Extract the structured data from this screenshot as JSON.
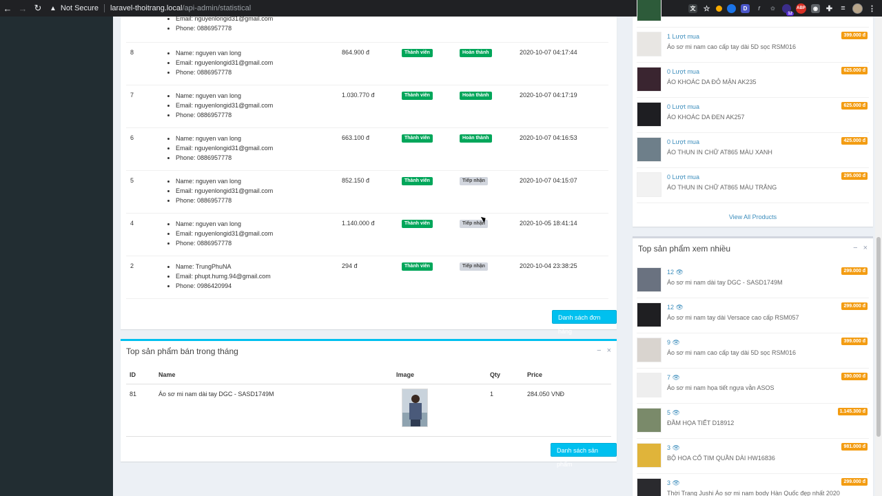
{
  "browser": {
    "security_label": "Not Secure",
    "url_host": "laravel-thoitrang.local",
    "url_path": "/api-admin/statistical",
    "ext_badge_count": "12",
    "ext_d_label": "D",
    "ext_abp_label": "ABP"
  },
  "orders": {
    "partial_top": {
      "email": "Email: nguyenlongid31@gmail.com",
      "phone": "Phone: 0886957778"
    },
    "rows": [
      {
        "id": "8",
        "name": "Name: nguyen van long",
        "email": "Email: nguyenlongid31@gmail.com",
        "phone": "Phone: 0886957778",
        "total": "864.900 đ",
        "type": "Thành viên",
        "status": "Hoàn thành",
        "status_type": "done",
        "date": "2020-10-07 04:17:44"
      },
      {
        "id": "7",
        "name": "Name: nguyen van long",
        "email": "Email: nguyenlongid31@gmail.com",
        "phone": "Phone: 0886957778",
        "total": "1.030.770 đ",
        "type": "Thành viên",
        "status": "Hoàn thành",
        "status_type": "done",
        "date": "2020-10-07 04:17:19"
      },
      {
        "id": "6",
        "name": "Name: nguyen van long",
        "email": "Email: nguyenlongid31@gmail.com",
        "phone": "Phone: 0886957778",
        "total": "663.100 đ",
        "type": "Thành viên",
        "status": "Hoàn thành",
        "status_type": "done",
        "date": "2020-10-07 04:16:53"
      },
      {
        "id": "5",
        "name": "Name: nguyen van long",
        "email": "Email: nguyenlongid31@gmail.com",
        "phone": "Phone: 0886957778",
        "total": "852.150 đ",
        "type": "Thành viên",
        "status": "Tiếp nhận",
        "status_type": "received",
        "date": "2020-10-07 04:15:07"
      },
      {
        "id": "4",
        "name": "Name: nguyen van long",
        "email": "Email: nguyenlongid31@gmail.com",
        "phone": "Phone: 0886957778",
        "total": "1.140.000 đ",
        "type": "Thành viên",
        "status": "Tiếp nhận",
        "status_type": "received",
        "date": "2020-10-05 18:41:14"
      },
      {
        "id": "2",
        "name": "Name: TrungPhuNA",
        "email": "Email: phupt.humg.94@gmail.com",
        "phone": "Phone: 0986420994",
        "total": "294 đ",
        "type": "Thành viên",
        "status": "Tiếp nhận",
        "status_type": "received",
        "date": "2020-10-04 23:38:25"
      }
    ],
    "list_button": "Danh sách đơn hàng"
  },
  "top_selling": {
    "title": "Top sản phẩm bán trong tháng",
    "minimize": "−",
    "close": "×",
    "headers": {
      "id": "ID",
      "name": "Name",
      "image": "Image",
      "qty": "Qty",
      "price": "Price"
    },
    "rows": [
      {
        "id": "81",
        "name": "Áo sơ mi nam dài tay DGC - SASD1749M",
        "qty": "1",
        "price": "284.050 VNĐ"
      }
    ],
    "list_button": "Danh sách sản phẩm"
  },
  "top_purchased": {
    "items": [
      {
        "title": "1 Lượt mua",
        "desc": "Áo sơ mi nam cao cấp tay dài 5D sọc RSM016",
        "price": "399.000 đ"
      },
      {
        "title": "0 Lượt mua",
        "desc": "ÁO KHOÁC DA ĐỎ MẬN AK235",
        "price": "625.000 đ"
      },
      {
        "title": "0 Lượt mua",
        "desc": "ÁO KHOÁC DA ĐEN AK257",
        "price": "625.000 đ"
      },
      {
        "title": "0 Lượt mua",
        "desc": "ÁO THUN IN CHỮ AT865 MÀU XANH",
        "price": "425.000 đ"
      },
      {
        "title": "0 Lượt mua",
        "desc": "ÁO THUN IN CHỮ AT865 MÀU TRẮNG",
        "price": "295.000 đ"
      }
    ],
    "view_all": "View All Products"
  },
  "top_viewed": {
    "title": "Top sản phẩm xem nhiều",
    "minimize": "−",
    "close": "×",
    "items": [
      {
        "views": "12",
        "desc": "Áo sơ mi nam dài tay DGC - SASD1749M",
        "price": "299.000 đ"
      },
      {
        "views": "12",
        "desc": "Áo sơ mi nam tay dài Versace cao cấp RSM057",
        "price": "299.000 đ"
      },
      {
        "views": "9",
        "desc": "Áo sơ mi nam cao cấp tay dài 5D sọc RSM016",
        "price": "399.000 đ"
      },
      {
        "views": "7",
        "desc": "Áo sơ mi nam họa tiết ngựa vằn ASOS",
        "price": "390.000 đ"
      },
      {
        "views": "5",
        "desc": "ĐẦM HỌA TIẾT D18912",
        "price": "1.145.300 đ"
      },
      {
        "views": "3",
        "desc": "BỘ HOA CỔ TIM QUẦN DÀI HW16836",
        "price": "981.000 đ"
      },
      {
        "views": "3",
        "desc": "Thời Trang Jushi Áo sơ mi nam body Hàn Quốc đẹp nhất 2020",
        "price": "299.000 đ"
      }
    ]
  },
  "colors": {
    "sidebar": "#222d32",
    "accent_info": "#00c0ef",
    "label_success": "#00a65a",
    "label_warning": "#f39c12",
    "link": "#3c8dbc"
  }
}
